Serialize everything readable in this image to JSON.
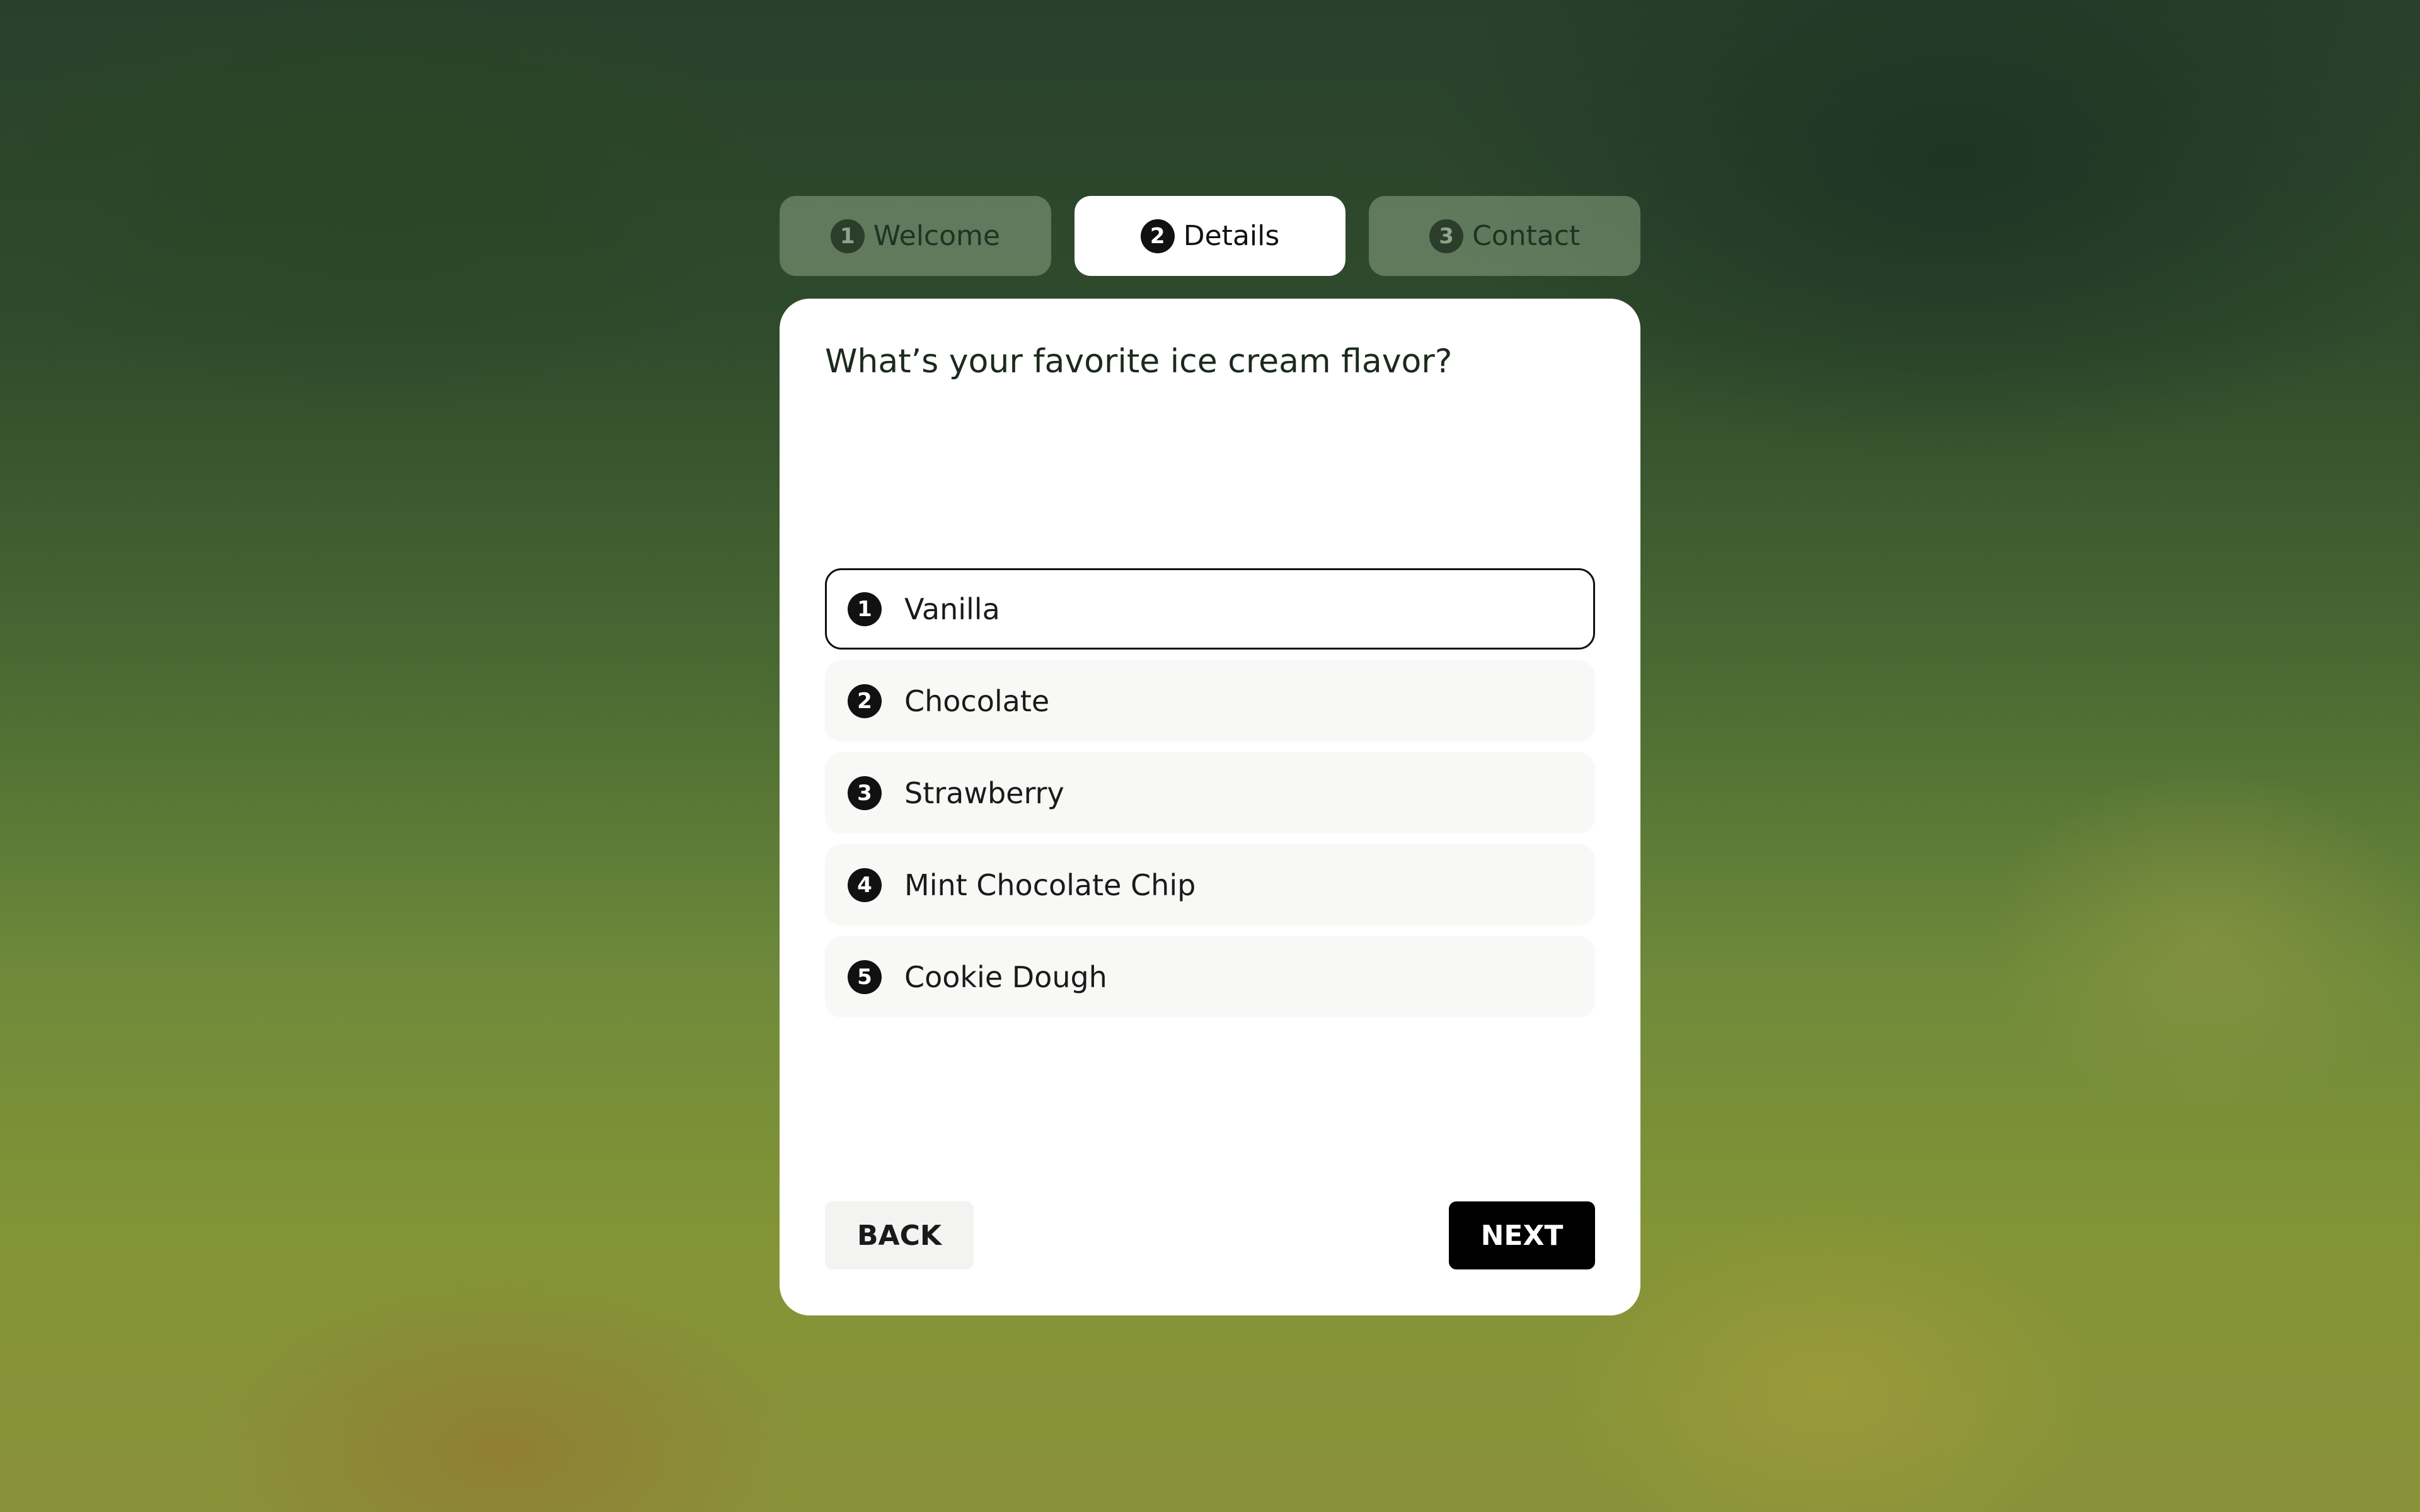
{
  "steps": [
    {
      "number": "1",
      "label": "Welcome",
      "state": "inactive"
    },
    {
      "number": "2",
      "label": "Details",
      "state": "active"
    },
    {
      "number": "3",
      "label": "Contact",
      "state": "inactive"
    }
  ],
  "form": {
    "question": "What’s your favorite ice cream flavor?",
    "selected_index": 0,
    "options": [
      {
        "number": "1",
        "label": "Vanilla"
      },
      {
        "number": "2",
        "label": "Chocolate"
      },
      {
        "number": "3",
        "label": "Strawberry"
      },
      {
        "number": "4",
        "label": "Mint Chocolate Chip"
      },
      {
        "number": "5",
        "label": "Cookie Dough"
      }
    ]
  },
  "actions": {
    "back_label": "BACK",
    "next_label": "NEXT"
  },
  "colors": {
    "accent": "#000000",
    "card_background": "#ffffff",
    "option_background": "#f8f8f6"
  }
}
